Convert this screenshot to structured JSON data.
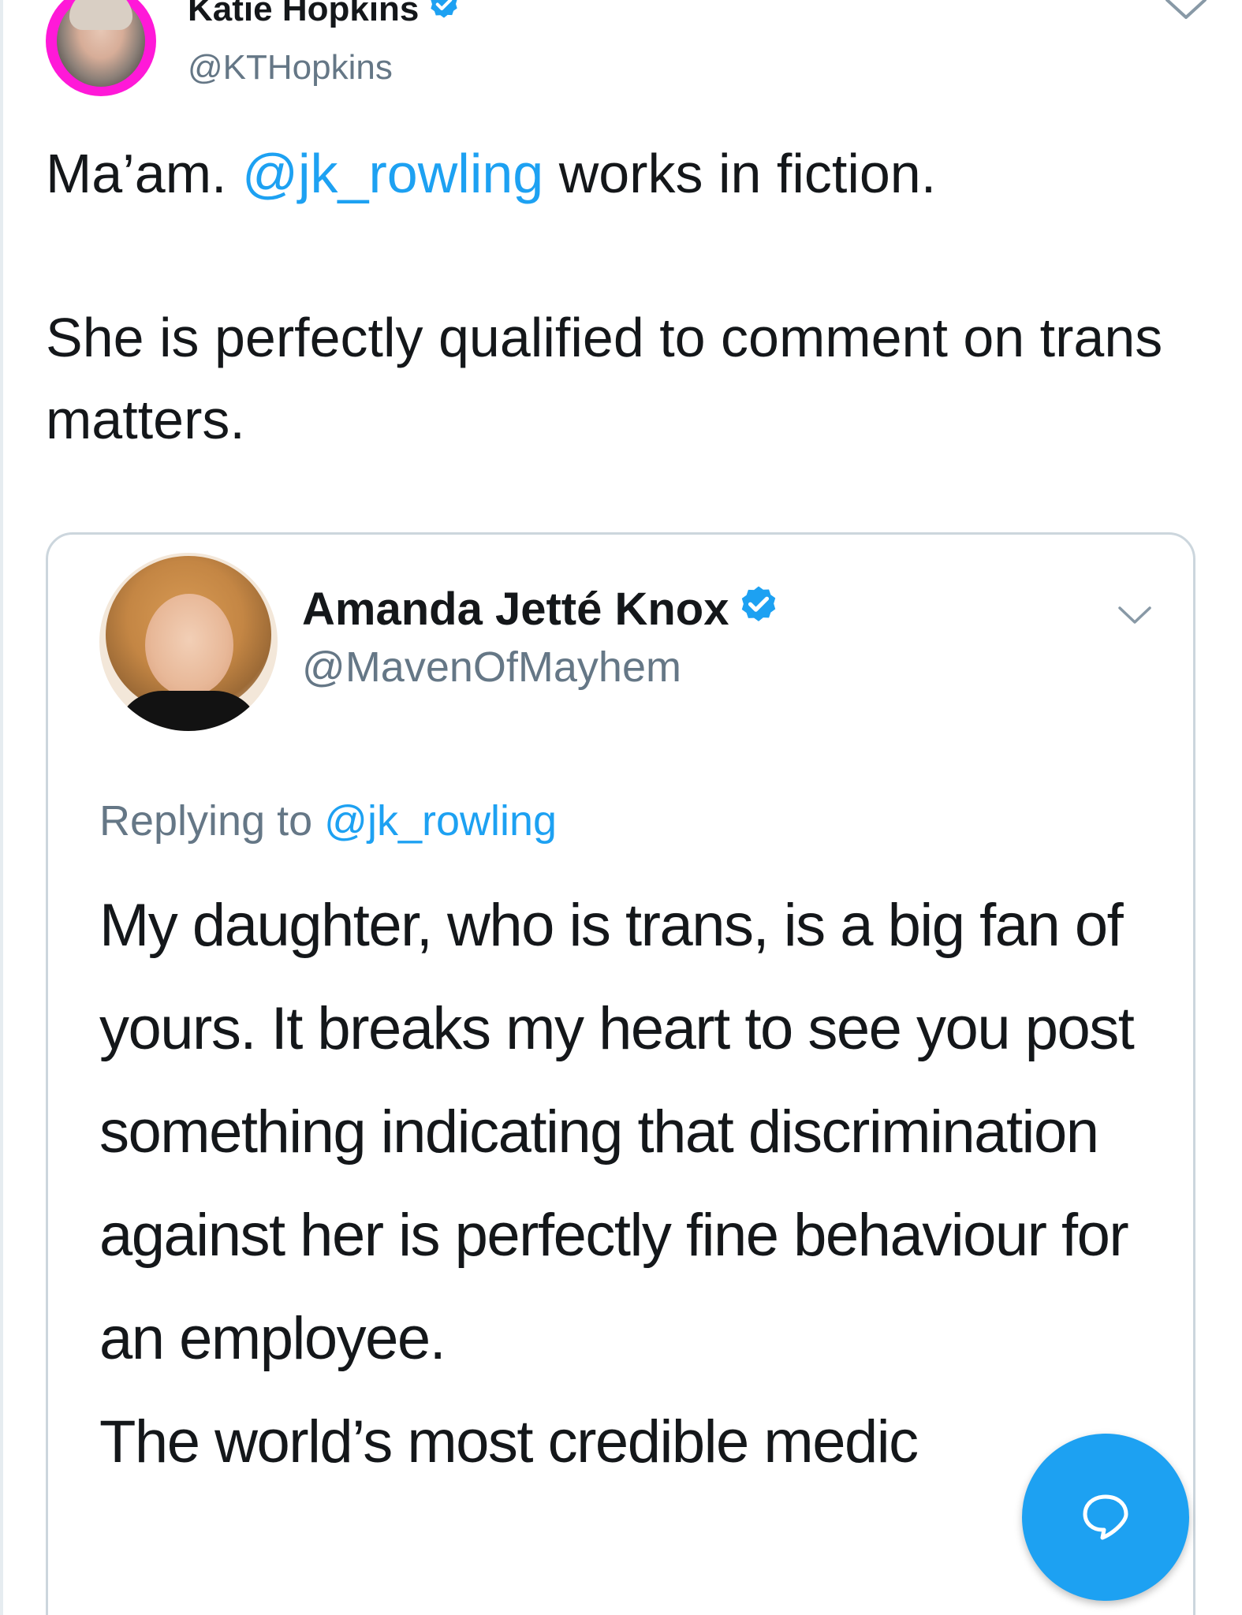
{
  "tweet": {
    "author_name": "Katie Hopkins",
    "author_handle": "@KTHopkins",
    "author_verified": true,
    "text_line1_before": "Ma’am. ",
    "text_line1_mention": "@jk_rowling",
    "text_line1_after": " works in fiction.",
    "text_paragraph2": "She is perfectly qualified to comment on trans matters."
  },
  "quoted_tweet": {
    "author_name": "Amanda Jetté Knox",
    "author_handle": "@MavenOfMayhem",
    "author_verified": true,
    "replying_prefix": "Replying to ",
    "replying_mention": "@jk_rowling",
    "text_paragraph1": "My daughter, who is trans, is a big fan of yours. It breaks my heart to see you post something indicating that discrimination against her is perfectly fine behaviour for an employee.",
    "text_paragraph2": "The world’s most credible medic"
  },
  "colors": {
    "accent": "#1da1f2",
    "text_primary": "#14171a",
    "text_secondary": "#657786",
    "border": "#ccd6dd",
    "avatar_ring": "#ff19d8"
  },
  "icons": {
    "verified": "verified-badge-icon",
    "more": "chevron-down-icon",
    "compose": "speech-bubble-icon"
  }
}
